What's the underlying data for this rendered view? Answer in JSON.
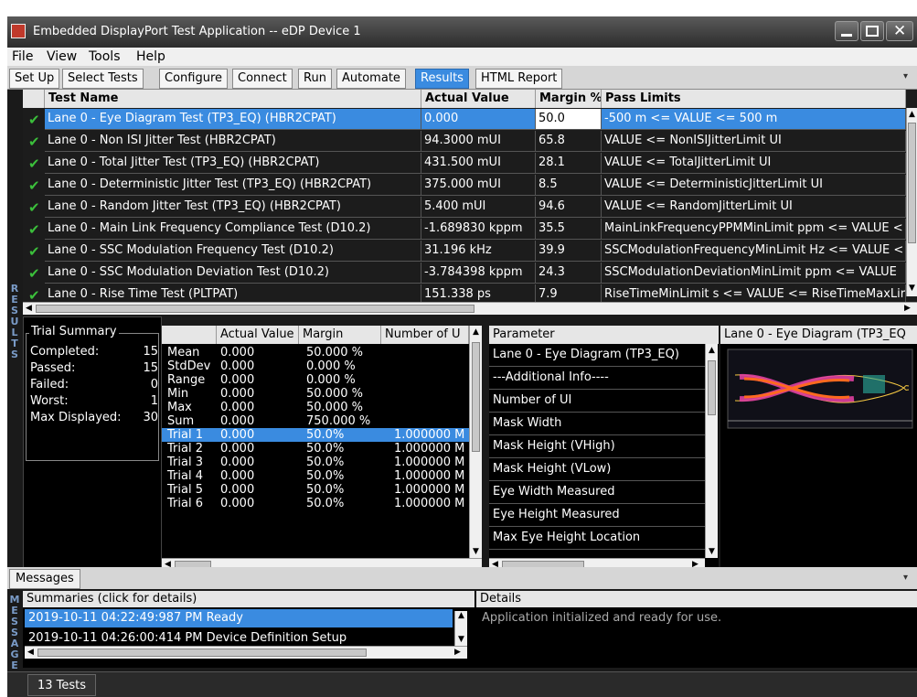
{
  "window": {
    "title": "Embedded DisplayPort Test Application -- eDP Device 1"
  },
  "menu": [
    "File",
    "View",
    "Tools",
    "Help"
  ],
  "tabs": [
    "Set Up",
    "Select Tests",
    "Configure",
    "Connect",
    "Run",
    "Automate",
    "Results",
    "HTML Report"
  ],
  "active_tab": "Results",
  "results": {
    "side_label": "RESULTS",
    "columns": [
      "Test Name",
      "Actual Value",
      "Margin %",
      "Pass Limits"
    ],
    "rows": [
      {
        "name": "Lane 0 - Eye Diagram Test (TP3_EQ) (HBR2CPAT)",
        "actual": "0.000",
        "margin": "50.0",
        "limits": "-500 m <= VALUE <= 500 m"
      },
      {
        "name": "Lane 0 - Non ISI Jitter Test (HBR2CPAT)",
        "actual": "94.3000 mUI",
        "margin": "65.8",
        "limits": "VALUE <= NonISIJitterLimit UI"
      },
      {
        "name": "Lane 0 - Total Jitter Test (TP3_EQ) (HBR2CPAT)",
        "actual": "431.500 mUI",
        "margin": "28.1",
        "limits": "VALUE <= TotalJitterLimit UI"
      },
      {
        "name": "Lane 0 - Deterministic Jitter Test (TP3_EQ) (HBR2CPAT)",
        "actual": "375.000 mUI",
        "margin": "8.5",
        "limits": "VALUE <= DeterministicJitterLimit UI"
      },
      {
        "name": "Lane 0 - Random Jitter Test (TP3_EQ) (HBR2CPAT)",
        "actual": "5.400 mUI",
        "margin": "94.6",
        "limits": "VALUE <= RandomJitterLimit UI"
      },
      {
        "name": "Lane 0 - Main Link Frequency Compliance Test (D10.2)",
        "actual": "-1.689830 kppm",
        "margin": "35.5",
        "limits": "MainLinkFrequencyPPMMinLimit ppm <= VALUE <"
      },
      {
        "name": "Lane 0 - SSC Modulation Frequency Test (D10.2)",
        "actual": "31.196 kHz",
        "margin": "39.9",
        "limits": "SSCModulationFrequencyMinLimit Hz <= VALUE <"
      },
      {
        "name": "Lane 0 - SSC Modulation Deviation Test (D10.2)",
        "actual": "-3.784398 kppm",
        "margin": "24.3",
        "limits": "SSCModulationDeviationMinLimit ppm <= VALUE"
      },
      {
        "name": "Lane 0 - Rise Time Test (PLTPAT)",
        "actual": "151.338 ps",
        "margin": "7.9",
        "limits": "RiseTimeMinLimit s <= VALUE <= RiseTimeMaxLir"
      }
    ]
  },
  "trial_summary": {
    "title": "Trial Summary",
    "items": [
      {
        "label": "Completed:",
        "value": "15"
      },
      {
        "label": "Passed:",
        "value": "15"
      },
      {
        "label": "Failed:",
        "value": "0"
      },
      {
        "label": "Worst:",
        "value": "1"
      },
      {
        "label": "Max Displayed:",
        "value": "30"
      }
    ]
  },
  "stats": {
    "columns": [
      "",
      "Actual Value",
      "Margin",
      "Number of U"
    ],
    "rows": [
      {
        "label": "Mean",
        "actual": "0.000",
        "margin": "50.000 %",
        "num": ""
      },
      {
        "label": "StdDev",
        "actual": "0.000",
        "margin": "0.000 %",
        "num": ""
      },
      {
        "label": "Range",
        "actual": "0.000",
        "margin": "0.000 %",
        "num": ""
      },
      {
        "label": "Min",
        "actual": "0.000",
        "margin": "50.000 %",
        "num": ""
      },
      {
        "label": "Max",
        "actual": "0.000",
        "margin": "50.000 %",
        "num": ""
      },
      {
        "label": "Sum",
        "actual": "0.000",
        "margin": "750.000 %",
        "num": ""
      },
      {
        "label": "Trial 1",
        "actual": "0.000",
        "margin": "50.0%",
        "num": "1.000000 M"
      },
      {
        "label": "Trial 2",
        "actual": "0.000",
        "margin": "50.0%",
        "num": "1.000000 M"
      },
      {
        "label": "Trial 3",
        "actual": "0.000",
        "margin": "50.0%",
        "num": "1.000000 M"
      },
      {
        "label": "Trial 4",
        "actual": "0.000",
        "margin": "50.0%",
        "num": "1.000000 M"
      },
      {
        "label": "Trial 5",
        "actual": "0.000",
        "margin": "50.0%",
        "num": "1.000000 M"
      },
      {
        "label": "Trial 6",
        "actual": "0.000",
        "margin": "50.0%",
        "num": "1.000000 M"
      }
    ]
  },
  "params": {
    "header": "Parameter",
    "rows": [
      "Lane 0 - Eye Diagram (TP3_EQ)",
      "---Additional Info----",
      "Number of UI",
      "Mask Width",
      "Mask Height (VHigh)",
      "Mask Height (VLow)",
      "Eye Width Measured",
      "Eye Height Measured",
      "Max Eye Height Location"
    ]
  },
  "eye_panel": {
    "header": "Lane 0 - Eye Diagram (TP3_EQ"
  },
  "messages": {
    "tab": "Messages",
    "side_label": "MESSAGES",
    "summaries_header": "Summaries (click for details)",
    "details_header": "Details",
    "rows": [
      "2019-10-11 04:22:49:987 PM Ready",
      "2019-10-11 04:26:00:414 PM Device Definition Setup"
    ],
    "details": "Application initialized and ready for use."
  },
  "status": {
    "tests": "13 Tests"
  }
}
